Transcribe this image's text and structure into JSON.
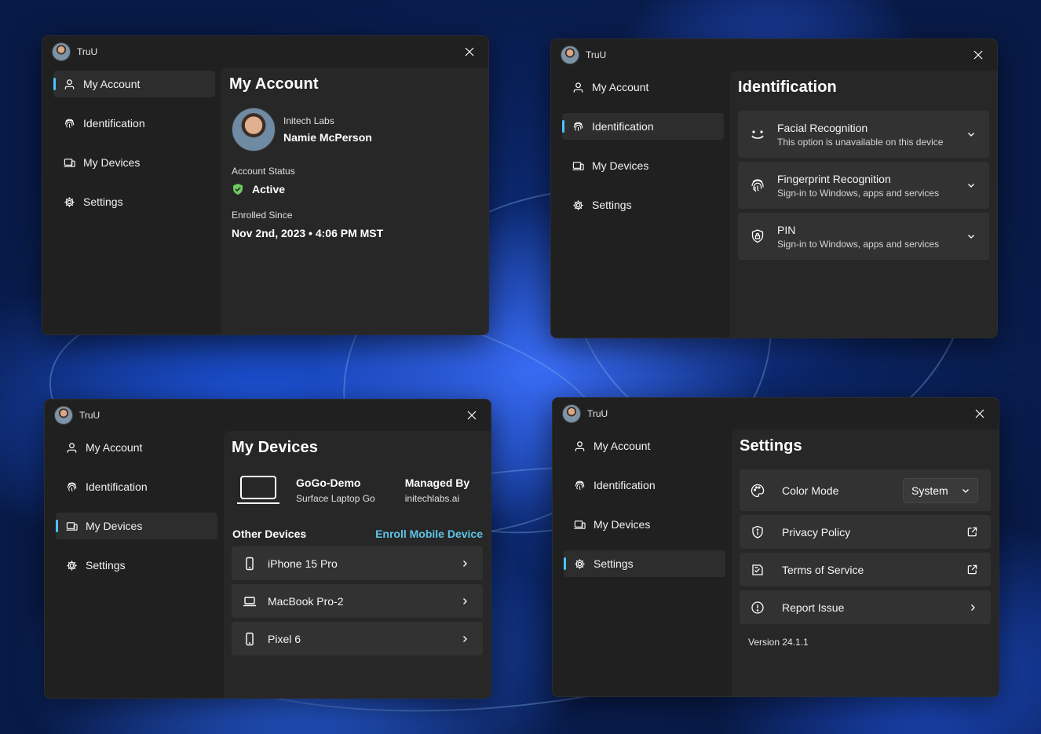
{
  "app": {
    "name": "TruU"
  },
  "nav": {
    "my_account": "My Account",
    "identification": "Identification",
    "my_devices": "My Devices",
    "settings": "Settings"
  },
  "account": {
    "title": "My Account",
    "org": "Initech Labs",
    "name": "Namie McPerson",
    "status_label": "Account Status",
    "status_value": "Active",
    "enrolled_label": "Enrolled Since",
    "enrolled_value": "Nov 2nd, 2023 • 4:06 PM MST"
  },
  "identification": {
    "title": "Identification",
    "items": [
      {
        "title": "Facial Recognition",
        "subtitle": "This option is unavailable on this device",
        "icon": "face-icon"
      },
      {
        "title": "Fingerprint Recognition",
        "subtitle": "Sign-in to Windows, apps and services",
        "icon": "fingerprint-icon"
      },
      {
        "title": "PIN",
        "subtitle": "Sign-in to Windows, apps and services",
        "icon": "pin-shield-icon"
      }
    ]
  },
  "devices": {
    "title": "My Devices",
    "current": {
      "name": "GoGo-Demo",
      "model": "Surface Laptop Go",
      "managed_label": "Managed By",
      "managed_value": "initechlabs.ai"
    },
    "other_label": "Other Devices",
    "enroll_label": "Enroll Mobile Device",
    "others": [
      {
        "name": "iPhone 15 Pro",
        "icon": "phone-icon"
      },
      {
        "name": "MacBook Pro-2",
        "icon": "laptop-icon"
      },
      {
        "name": "Pixel 6",
        "icon": "phone-icon"
      }
    ]
  },
  "settings": {
    "title": "Settings",
    "color_mode_label": "Color Mode",
    "color_mode_value": "System",
    "privacy_label": "Privacy Policy",
    "terms_label": "Terms of Service",
    "report_label": "Report Issue",
    "version": "Version 24.1.1"
  },
  "colors": {
    "accent": "#4cc2ff",
    "link": "#5ec6e8",
    "success": "#6ccb5f"
  }
}
